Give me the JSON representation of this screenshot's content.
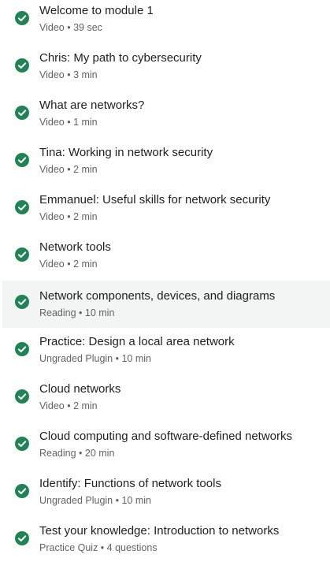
{
  "colors": {
    "check": "#1f8354",
    "active_row_bg": "#f3f4f4",
    "title_text": "#1f1f1f",
    "meta_text": "#636363"
  },
  "items": [
    {
      "title": "Welcome to module 1",
      "meta": "Video • 39 sec",
      "status": "completed",
      "icon": "check-circle-icon"
    },
    {
      "title": "Chris: My path to cybersecurity",
      "meta": "Video • 3 min",
      "status": "completed",
      "icon": "check-circle-icon"
    },
    {
      "title": "What are networks?",
      "meta": "Video • 1 min",
      "status": "completed",
      "icon": "check-circle-icon"
    },
    {
      "title": "Tina: Working in network security",
      "meta": "Video • 2 min",
      "status": "completed",
      "icon": "check-circle-icon"
    },
    {
      "title": "Emmanuel: Useful skills for network security",
      "meta": "Video • 2 min",
      "status": "completed",
      "icon": "check-circle-icon"
    },
    {
      "title": "Network tools",
      "meta": "Video • 2 min",
      "status": "completed",
      "icon": "check-circle-icon"
    },
    {
      "title": "Network components, devices, and diagrams",
      "meta": "Reading • 10 min",
      "status": "completed",
      "icon": "check-circle-icon"
    },
    {
      "title": "Practice: Design a local area network",
      "meta": "Ungraded Plugin • 10 min",
      "status": "completed",
      "icon": "check-circle-icon"
    },
    {
      "title": "Cloud networks",
      "meta": "Video • 2 min",
      "status": "completed",
      "icon": "check-circle-icon"
    },
    {
      "title": "Cloud computing and software-defined networks",
      "meta": "Reading • 20 min",
      "status": "completed",
      "icon": "check-circle-icon"
    },
    {
      "title": "Identify: Functions of network tools",
      "meta": "Ungraded Plugin • 10 min",
      "status": "completed",
      "icon": "check-circle-icon"
    },
    {
      "title": "Test your knowledge: Introduction to networks",
      "meta": "Practice Quiz • 4 questions",
      "status": "completed",
      "icon": "check-circle-icon"
    }
  ]
}
